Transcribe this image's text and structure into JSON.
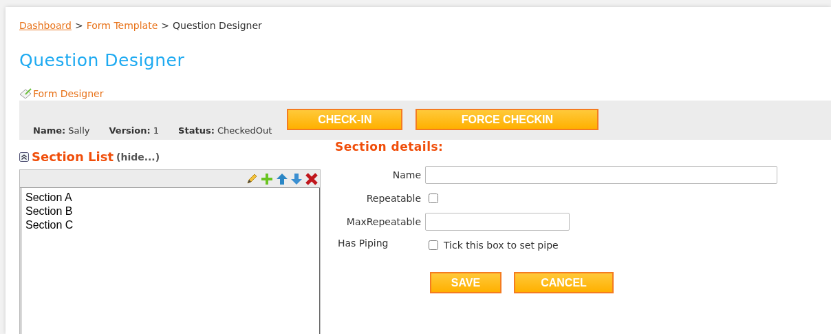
{
  "breadcrumb": [
    {
      "kind": "link",
      "label": "Dashboard",
      "underlined": true
    },
    {
      "kind": "separator",
      "label": ">"
    },
    {
      "kind": "link",
      "label": "Form Template",
      "underlined": false
    },
    {
      "kind": "separator",
      "label": ">"
    },
    {
      "kind": "current",
      "label": "Question Designer"
    }
  ],
  "page_title": "Question Designer",
  "designer_link": "Form Designer",
  "record_info": [
    {
      "label": "Name:",
      "value": "Sally"
    },
    {
      "label": "Version:",
      "value": "1"
    },
    {
      "label": "Status:",
      "value": "CheckedOut"
    }
  ],
  "header_buttons": [
    "CHECK-IN",
    "FORCE CHECKIN"
  ],
  "section_list": {
    "title": "Section List",
    "toggle": "(hide...)",
    "items": [
      "Section A",
      "Section B",
      "Section C"
    ]
  },
  "section_details": {
    "title": "Section details:",
    "fields": [
      {
        "kind": "text",
        "label": "Name",
        "wide": true
      },
      {
        "kind": "checkbox",
        "label": "Repeatable",
        "checked": false
      },
      {
        "kind": "text",
        "label": "MaxRepeatable",
        "wide": false
      },
      {
        "kind": "checkbox",
        "label": "Has Piping",
        "checked": false,
        "caption": "Tick this box to set pipe"
      }
    ],
    "buttons": [
      "SAVE",
      "CANCEL"
    ]
  }
}
